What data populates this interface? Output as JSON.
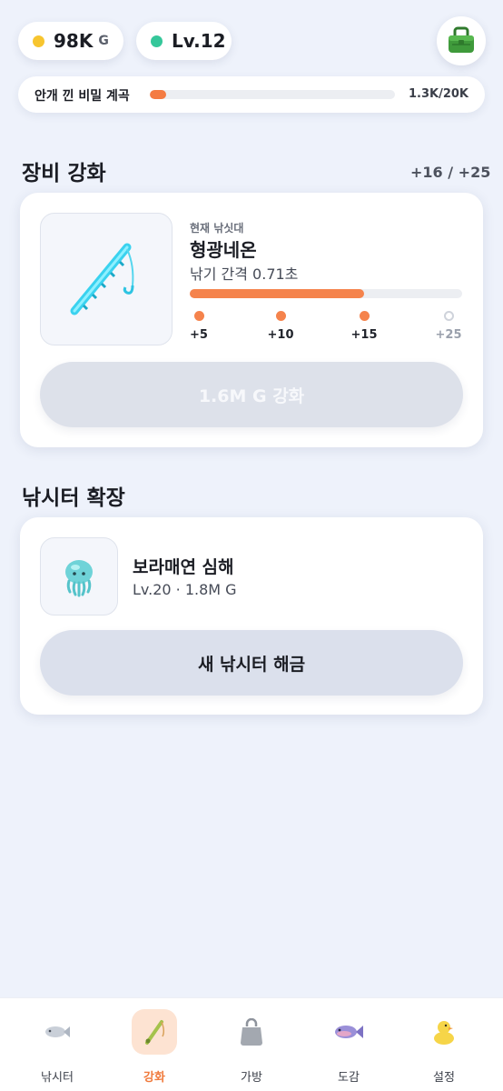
{
  "header": {
    "gold": {
      "value": "98K",
      "unit": "G",
      "dot_color": "#f7c52f"
    },
    "level": {
      "value": "Lv.12",
      "dot_color": "#35c79a"
    },
    "bag_icon": "tackle-box-icon"
  },
  "quest": {
    "label": "안개 낀 비밀 계곡",
    "count": "1.3K/20K",
    "progress": 0.065
  },
  "upgrade": {
    "title": "장비 강화",
    "meta": "+16 / +25",
    "current_caption": "현재 낚싯대",
    "rod_name": "형광네온",
    "interval": "낚기 간격 0.71초",
    "progress": 0.64,
    "milestones": [
      {
        "label": "+5",
        "reached": true
      },
      {
        "label": "+10",
        "reached": true
      },
      {
        "label": "+15",
        "reached": true
      },
      {
        "label": "+25",
        "reached": false
      }
    ],
    "button_label": "1.6M G 강화",
    "button_enabled": false
  },
  "expand": {
    "title": "낚시터 확장",
    "spot_name": "보라매연 심해",
    "spot_req": "Lv.20 · 1.8M G",
    "button_label": "새 낚시터 해금"
  },
  "nav": {
    "items": [
      {
        "label": "낚시터",
        "icon": "fish-icon"
      },
      {
        "label": "강화",
        "icon": "fishing-rod-icon",
        "active": true
      },
      {
        "label": "가방",
        "icon": "bag-icon"
      },
      {
        "label": "도감",
        "icon": "collection-fish-icon"
      },
      {
        "label": "설정",
        "icon": "duck-icon"
      }
    ]
  },
  "colors": {
    "accent": "#f47b42",
    "background": "#eef2fb"
  }
}
